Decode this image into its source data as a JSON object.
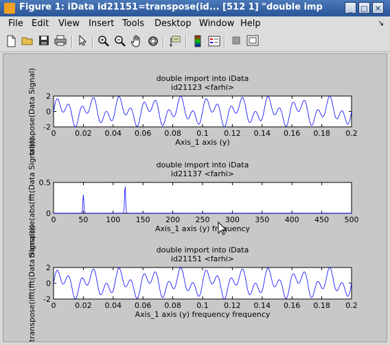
{
  "window": {
    "title": "Figure 1: iData id21151=transpose(id...  [512    1] \"double imp",
    "minimize_label": "_",
    "maximize_label": "□",
    "close_label": "✕"
  },
  "menu": [
    "File",
    "Edit",
    "View",
    "Insert",
    "Tools",
    "Desktop",
    "Window",
    "Help"
  ],
  "menu_extra": "↘",
  "toolbar_icons": [
    "new-file-icon",
    "open-folder-icon",
    "save-icon",
    "print-icon",
    "pointer-icon",
    "zoom-in-icon",
    "zoom-out-icon",
    "pan-hand-icon",
    "rotate-3d-icon",
    "data-cursor-icon",
    "colorbar-icon",
    "legend-icon",
    "hide-plot-tools-icon",
    "show-plot-tools-icon"
  ],
  "plots": [
    {
      "title1": "double import into iData",
      "title2": "id21123 <farhi>",
      "xlabel": "Axis_1 axis (y)",
      "ylabel": "transpose(Data Signal)",
      "xticks": [
        "0",
        "0.02",
        "0.04",
        "0.06",
        "0.08",
        "0.1",
        "0.12",
        "0.14",
        "0.16",
        "0.18",
        "0.2"
      ],
      "yticks": [
        "2",
        "0",
        "-2"
      ]
    },
    {
      "title1": "double import into iData",
      "title2": "id21137 <farhi>",
      "xlabel": "Axis_1 axis (y) frequency",
      "ylabel": "transpose(abs(fft(Data Signal)))",
      "xticks": [
        "0",
        "50",
        "100",
        "150",
        "200",
        "250",
        "300",
        "350",
        "400",
        "450",
        "500"
      ],
      "yticks": [
        "0.5",
        "0"
      ]
    },
    {
      "title1": "double import into iData",
      "title2": "id21151 <farhi>",
      "xlabel": "Axis_1 axis (y) frequency frequency",
      "ylabel": "transpose(ifft(fft(Data Signal)))",
      "xticks": [
        "0",
        "0.02",
        "0.04",
        "0.06",
        "0.08",
        "0.1",
        "0.12",
        "0.14",
        "0.16",
        "0.18",
        "0.2"
      ],
      "yticks": [
        "2",
        "0",
        "-2"
      ]
    }
  ],
  "colors": {
    "line": "#0000ff",
    "titlebar": "#3566a8"
  },
  "chart_data": [
    {
      "type": "line",
      "xlim": [
        0,
        0.2
      ],
      "ylim": [
        -2,
        2
      ],
      "series": [
        {
          "signal": "sin(2*pi*50*t) + sin(2*pi*120*t)",
          "t_range": [
            0,
            0.2
          ]
        }
      ]
    },
    {
      "type": "line",
      "xlim": [
        0,
        500
      ],
      "ylim": [
        0,
        0.5
      ],
      "series": [
        {
          "peaks": [
            {
              "x": 50,
              "y": 0.3
            },
            {
              "x": 120,
              "y": 0.47
            }
          ]
        }
      ]
    },
    {
      "type": "line",
      "xlim": [
        0,
        0.2
      ],
      "ylim": [
        -2,
        2
      ],
      "series": [
        {
          "signal": "sin(2*pi*50*t) + sin(2*pi*120*t)",
          "t_range": [
            0,
            0.2
          ]
        }
      ]
    }
  ]
}
